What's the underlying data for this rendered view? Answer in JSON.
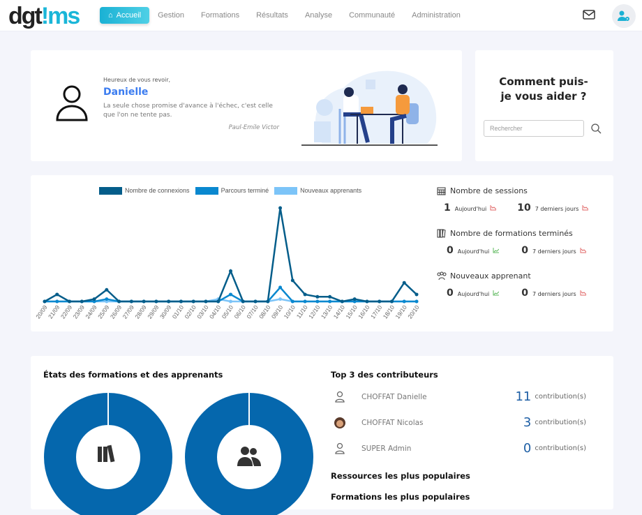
{
  "header": {
    "logo": "dgt!ms",
    "nav": [
      {
        "label": "Accueil",
        "active": true
      },
      {
        "label": "Gestion"
      },
      {
        "label": "Formations"
      },
      {
        "label": "Résultats"
      },
      {
        "label": "Analyse"
      },
      {
        "label": "Communauté"
      },
      {
        "label": "Administration"
      }
    ],
    "icons": [
      "home-icon",
      "mail-icon",
      "user-settings-icon"
    ]
  },
  "welcome": {
    "greeting": "Heureux de vous revoir,",
    "name": "Danielle",
    "quote": "La seule chose promise d'avance à l'échec, c'est celle que l'on ne tente pas.",
    "author": "Paul-Emile Victor"
  },
  "help": {
    "title": "Comment puis-je vous aider ?",
    "search_placeholder": "Rechercher"
  },
  "chart_data": {
    "type": "line",
    "categories": [
      "20/09",
      "21/09",
      "22/09",
      "23/09",
      "24/09",
      "25/09",
      "26/09",
      "27/09",
      "28/09",
      "29/09",
      "30/09",
      "01/10",
      "02/10",
      "03/10",
      "04/10",
      "05/10",
      "06/10",
      "07/10",
      "08/10",
      "09/10",
      "10/10",
      "11/10",
      "12/10",
      "13/10",
      "14/10",
      "15/10",
      "16/10",
      "17/10",
      "18/10",
      "19/10",
      "20/10"
    ],
    "series": [
      {
        "name": "Nombre de connexions",
        "color": "#045d8a",
        "values": [
          0,
          3,
          0,
          0,
          1,
          5,
          0,
          0,
          0,
          0,
          0,
          0,
          0,
          0,
          0,
          13,
          0,
          0,
          0,
          40,
          9,
          3,
          2,
          2,
          0,
          1,
          0,
          0,
          0,
          8,
          3
        ]
      },
      {
        "name": "Parcours terminé",
        "color": "#0a88cf",
        "values": [
          0,
          0,
          0,
          0,
          0,
          1,
          0,
          0,
          0,
          0,
          0,
          0,
          0,
          0,
          0,
          3,
          0,
          0,
          0,
          6,
          0,
          0,
          0,
          0,
          0,
          0,
          0,
          0,
          0,
          0,
          0
        ]
      },
      {
        "name": "Nouveaux apprenants",
        "color": "#7cc4f8",
        "values": [
          0,
          0,
          0,
          0,
          0,
          0,
          0,
          0,
          0,
          0,
          0,
          0,
          0,
          0,
          1,
          0,
          0,
          0,
          0,
          1,
          0,
          0,
          0,
          0,
          0,
          0,
          0,
          0,
          0,
          0,
          0
        ]
      }
    ],
    "ylim": [
      0,
      40
    ],
    "grid": false,
    "legend": "top"
  },
  "stats": [
    {
      "title": "Nombre de sessions",
      "icon": "calendar-icon",
      "today": "1",
      "today_label": "Aujourd'hui",
      "week": "10",
      "week_label": "7 derniers jours",
      "today_trend": "down",
      "week_trend": "down"
    },
    {
      "title": "Nombre de formations terminés",
      "icon": "books-icon",
      "today": "0",
      "today_label": "Aujourd'hui",
      "week": "0",
      "week_label": "7 derniers jours",
      "today_trend": "up",
      "week_trend": "down"
    },
    {
      "title": "Nouveaux apprenant",
      "icon": "users-icon",
      "today": "0",
      "today_label": "Aujourd'hui",
      "week": "0",
      "week_label": "7 derniers jours",
      "today_trend": "up",
      "week_trend": "down"
    }
  ],
  "bottom": {
    "states_title": "États des formations et des apprenants",
    "donut_color": "#0567ad",
    "top_title": "Top 3 des contributeurs",
    "contributors": [
      {
        "name": "CHOFFAT Danielle",
        "count": "11",
        "label": "contribution(s)"
      },
      {
        "name": "CHOFFAT Nicolas",
        "count": "3",
        "label": "contribution(s)"
      },
      {
        "name": "SUPER Admin",
        "count": "0",
        "label": "contribution(s)"
      }
    ],
    "resources_title": "Ressources les plus populaires",
    "formations_title": "Formations les plus populaires"
  }
}
